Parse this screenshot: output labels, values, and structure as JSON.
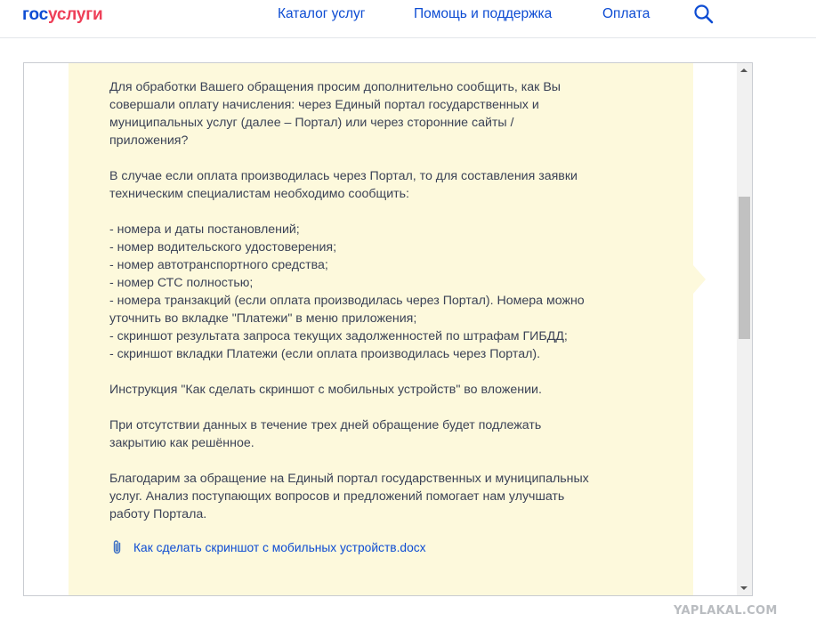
{
  "header": {
    "logo": {
      "part1": "гос",
      "part2": "услуги"
    },
    "nav": {
      "catalog": "Каталог услуг",
      "help": "Помощь и поддержка",
      "payment": "Оплата"
    },
    "search_icon": "search-icon"
  },
  "message": {
    "paragraphs": [
      "Для обработки Вашего обращения просим дополнительно сообщить, как Вы\nсовершали оплату начисления: через Единый портал государственных и\nмуниципальных услуг (далее – Портал) или через сторонние сайты /\nприложения?",
      "В случае если оплата производилась через Портал, то для составления заявки\nтехническим специалистам необходимо сообщить:",
      "- номера и даты постановлений;\n- номер водительского удостоверения;\n- номер автотранспортного средства;\n- номер СТС полностью;\n- номера транзакций (если оплата производилась через Портал). Номера можно\nуточнить во вкладке \"Платежи\" в меню приложения;\n- скриншот результата запроса текущих задолженностей по штрафам ГИБДД;\n- скриншот вкладки Платежи (если оплата производилась через Портал).",
      "Инструкция \"Как сделать скриншот с мобильных устройств\" во вложении.",
      "При отсутствии данных в течение трех дней обращение будет подлежать\nзакрытию как решённое.",
      "Благодарим за обращение на Единый портал государственных и муниципальных\nуслуг. Анализ поступающих вопросов и предложений помогает нам улучшать\nработу Портала."
    ],
    "attachment": {
      "name": "Как сделать скриншот с мобильных устройств.docx",
      "icon": "paperclip-icon"
    }
  },
  "watermark": "YAPLAKAL.COM",
  "colors": {
    "brand_blue": "#0d4cd3",
    "brand_red": "#ee3f58",
    "bubble_bg": "#fdf9dc",
    "text": "#3b4256"
  }
}
